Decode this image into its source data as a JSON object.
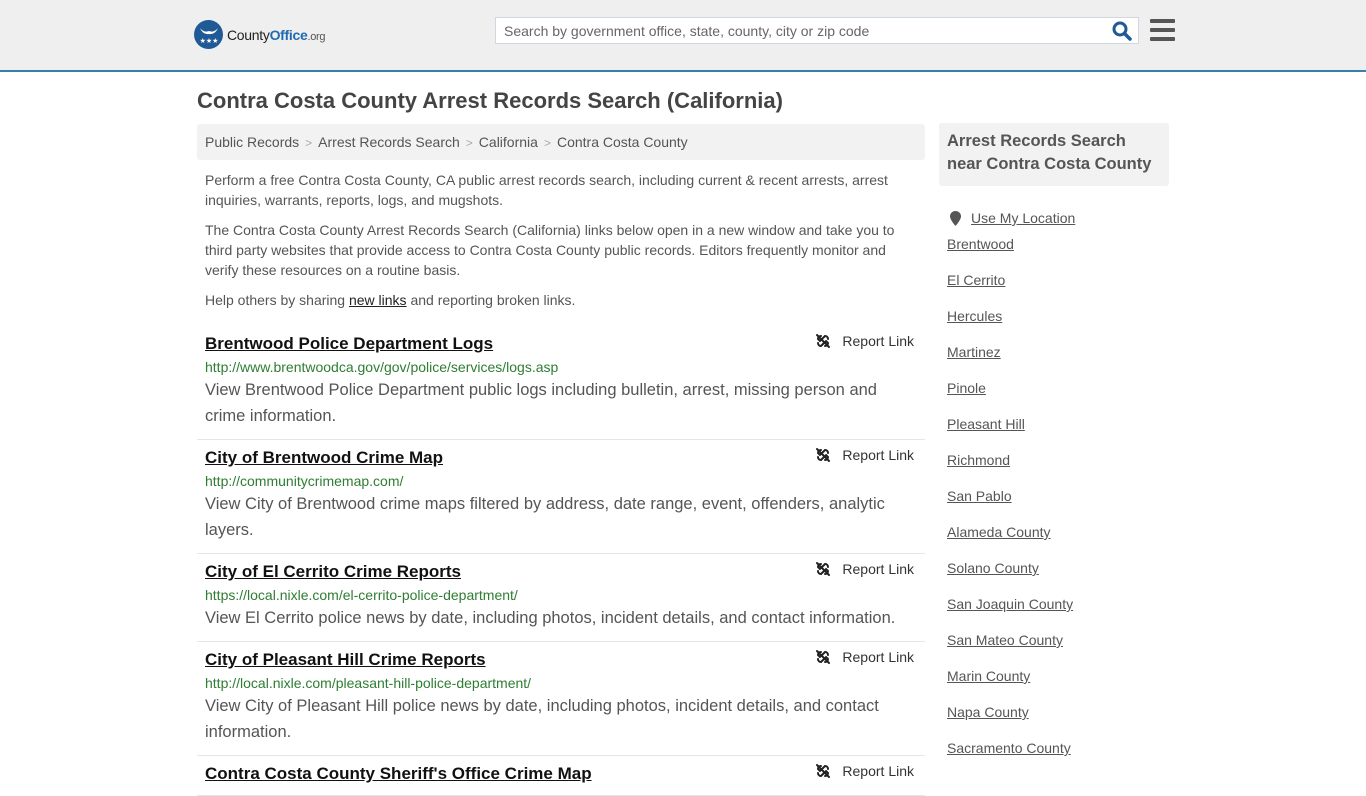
{
  "header": {
    "logo": {
      "name": "County",
      "name_bold": "Office",
      "tld": ".org"
    },
    "search": {
      "placeholder": "Search by government office, state, county, city or zip code",
      "value": ""
    },
    "colors": {
      "brand_blue": "#1f5a96",
      "header_border": "#3a7eb0"
    }
  },
  "page": {
    "title": "Contra Costa County Arrest Records Search (California)",
    "breadcrumb": [
      "Public Records",
      "Arrest Records Search",
      "California",
      "Contra Costa County"
    ],
    "intro": {
      "p1": "Perform a free Contra Costa County, CA public arrest records search, including current & recent arrests, arrest inquiries, warrants, reports, logs, and mugshots.",
      "p2": "The Contra Costa County Arrest Records Search (California) links below open in a new window and take you to third party websites that provide access to Contra Costa County public records. Editors frequently monitor and verify these resources on a routine basis.",
      "p3_before": "Help others by sharing ",
      "p3_link": "new links",
      "p3_after": " and reporting broken links."
    }
  },
  "results": [
    {
      "title": "Brentwood Police Department Logs",
      "url": "http://www.brentwoodca.gov/gov/police/services/logs.asp",
      "description": "View Brentwood Police Department public logs including bulletin, arrest, missing person and crime information.",
      "report_label": "Report Link"
    },
    {
      "title": "City of Brentwood Crime Map",
      "url": "http://communitycrimemap.com/",
      "description": "View City of Brentwood crime maps filtered by address, date range, event, offenders, analytic layers.",
      "report_label": "Report Link"
    },
    {
      "title": "City of El Cerrito Crime Reports",
      "url": "https://local.nixle.com/el-cerrito-police-department/",
      "description": "View El Cerrito police news by date, including photos, incident details, and contact information.",
      "report_label": "Report Link"
    },
    {
      "title": "City of Pleasant Hill Crime Reports",
      "url": "http://local.nixle.com/pleasant-hill-police-department/",
      "description": "View City of Pleasant Hill police news by date, including photos, incident details, and contact information.",
      "report_label": "Report Link"
    },
    {
      "title": "Contra Costa County Sheriff's Office Crime Map",
      "url": "",
      "description": "",
      "report_label": "Report Link"
    }
  ],
  "sidebar": {
    "heading": "Arrest Records Search near Contra Costa County",
    "use_location": "Use My Location",
    "links": [
      "Brentwood",
      "El Cerrito",
      "Hercules",
      "Martinez",
      "Pinole",
      "Pleasant Hill",
      "Richmond",
      "San Pablo",
      "Alameda County",
      "Solano County",
      "San Joaquin County",
      "San Mateo County",
      "Marin County",
      "Napa County",
      "Sacramento County"
    ]
  }
}
